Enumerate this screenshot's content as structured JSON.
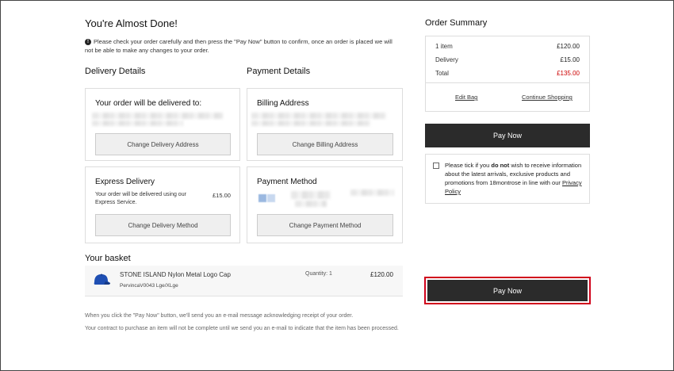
{
  "page": {
    "title": "You're Almost Done!",
    "notice": "Please check your order carefully and then press the \"Pay Now\" button to confirm, once an order is placed we will not be able to make any changes to your order."
  },
  "sections": {
    "delivery_details": "Delivery Details",
    "payment_details": "Payment Details",
    "basket": "Your basket"
  },
  "delivery_box": {
    "title": "Your order will be delivered to:",
    "button": "Change Delivery Address"
  },
  "express_box": {
    "title": "Express Delivery",
    "text": "Your order will be delivered using our Express Service.",
    "price": "£15.00",
    "button": "Change Delivery Method"
  },
  "billing_box": {
    "title": "Billing Address",
    "button": "Change Billing Address"
  },
  "payment_box": {
    "title": "Payment Method",
    "button": "Change Payment Method"
  },
  "basket_item": {
    "name": "STONE ISLAND Nylon Metal Logo Cap",
    "variant": "PervincaV0043 Lge/XLge",
    "quantity": "Quantity: 1",
    "price": "£120.00"
  },
  "footer": {
    "line1": "When you click the \"Pay Now\" button, we'll send you an e-mail message acknowledging receipt of your order.",
    "line2": "Your contract to purchase an item will not be complete until we send you an e-mail to indicate that the item has been processed."
  },
  "summary": {
    "title": "Order Summary",
    "items_label": "1 item",
    "items_value": "£120.00",
    "delivery_label": "Delivery",
    "delivery_value": "£15.00",
    "total_label": "Total",
    "total_value": "£135.00",
    "edit_bag": "Edit Bag",
    "continue_shopping": "Continue Shopping",
    "pay_now": "Pay Now"
  },
  "marketing": {
    "text_before": "Please tick if you ",
    "text_bold": "do not",
    "text_after": " wish to receive information about the latest arrivals, exclusive products and promotions from 18montrose in line with our ",
    "privacy_link": "Privacy Policy"
  },
  "bottom_pay_now": "Pay Now",
  "colors": {
    "dark_button": "#2b2b2b",
    "total_red": "#cc0000",
    "highlight_border": "#d0021b"
  }
}
